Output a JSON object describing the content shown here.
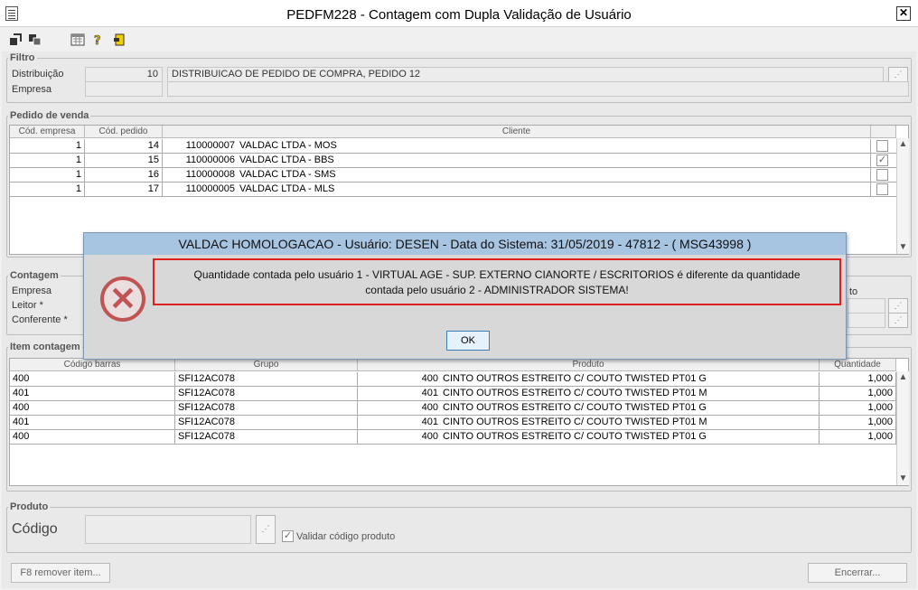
{
  "window": {
    "title": "PEDFM228 - Contagem com Dupla Validação de Usuário",
    "close_label": "✕"
  },
  "toolbar": {
    "icons": [
      "export-icon",
      "copy-icon",
      "calculator-icon",
      "help-icon",
      "exit-icon"
    ]
  },
  "filtro": {
    "legend": "Filtro",
    "distribuicao_label": "Distribuição",
    "distribuicao_code": "10",
    "distribuicao_desc": "DISTRIBUICAO DE PEDIDO DE COMPRA, PEDIDO 12",
    "empresa_label": "Empresa",
    "empresa_value": ""
  },
  "pedido": {
    "legend": "Pedido de venda",
    "headers": [
      "Cód. empresa",
      "Cód. pedido",
      "Cliente",
      ""
    ],
    "rows": [
      {
        "empresa": "1",
        "pedido": "14",
        "cliente_code": "110000007",
        "cliente_name": "VALDAC LTDA - MOS",
        "checked": ""
      },
      {
        "empresa": "1",
        "pedido": "15",
        "cliente_code": "110000006",
        "cliente_name": "VALDAC LTDA - BBS",
        "checked": "✓"
      },
      {
        "empresa": "1",
        "pedido": "16",
        "cliente_code": "110000008",
        "cliente_name": "VALDAC LTDA - SMS",
        "checked": ""
      },
      {
        "empresa": "1",
        "pedido": "17",
        "cliente_code": "110000005",
        "cliente_name": "VALDAC LTDA - MLS",
        "checked": ""
      }
    ]
  },
  "contagem": {
    "legend": "Contagem",
    "empresa_label": "Empresa",
    "leitor_label": "Leitor *",
    "conferente_label": "Conferente *",
    "right_fragment": "to"
  },
  "item": {
    "legend": "Item contagem",
    "headers": [
      "Código barras",
      "Grupo",
      "Produto",
      "Quantidade"
    ],
    "rows": [
      {
        "barras": "400",
        "grupo": "SFI12AC078",
        "prod_code": "400",
        "prod_name": "CINTO OUTROS ESTREITO C/ COUTO TWISTED PT01 G",
        "qtd": "1,000"
      },
      {
        "barras": "401",
        "grupo": "SFI12AC078",
        "prod_code": "401",
        "prod_name": "CINTO OUTROS ESTREITO C/ COUTO TWISTED PT01 M",
        "qtd": "1,000"
      },
      {
        "barras": "400",
        "grupo": "SFI12AC078",
        "prod_code": "400",
        "prod_name": "CINTO OUTROS ESTREITO C/ COUTO TWISTED PT01 G",
        "qtd": "1,000"
      },
      {
        "barras": "401",
        "grupo": "SFI12AC078",
        "prod_code": "401",
        "prod_name": "CINTO OUTROS ESTREITO C/ COUTO TWISTED PT01 M",
        "qtd": "1,000"
      },
      {
        "barras": "400",
        "grupo": "SFI12AC078",
        "prod_code": "400",
        "prod_name": "CINTO OUTROS ESTREITO C/ COUTO TWISTED PT01 G",
        "qtd": "1,000"
      }
    ]
  },
  "produto": {
    "legend": "Produto",
    "codigo_label": "Código",
    "validar_label": "Validar código produto",
    "validar_checked": "✓"
  },
  "footer": {
    "remover_label": "F8 remover item...",
    "encerrar_label": "Encerrar..."
  },
  "dialog": {
    "title": "VALDAC HOMOLOGACAO - Usuário: DESEN - Data do Sistema: 31/05/2019 - 47812 - ( MSG43998 )",
    "message_line1": "Quantidade contada pelo usuário 1 - VIRTUAL AGE - SUP. EXTERNO CIANORTE / ESCRITORIOS é diferente da quantidade",
    "message_line2": "contada pelo usuário 2 - ADMINISTRADOR SISTEMA!",
    "ok_label": "OK",
    "error_glyph": "✕"
  },
  "colors": {
    "dialog_title_bg": "#a7c4e1",
    "error_red": "#c05454",
    "highlight_border": "#e02020"
  }
}
